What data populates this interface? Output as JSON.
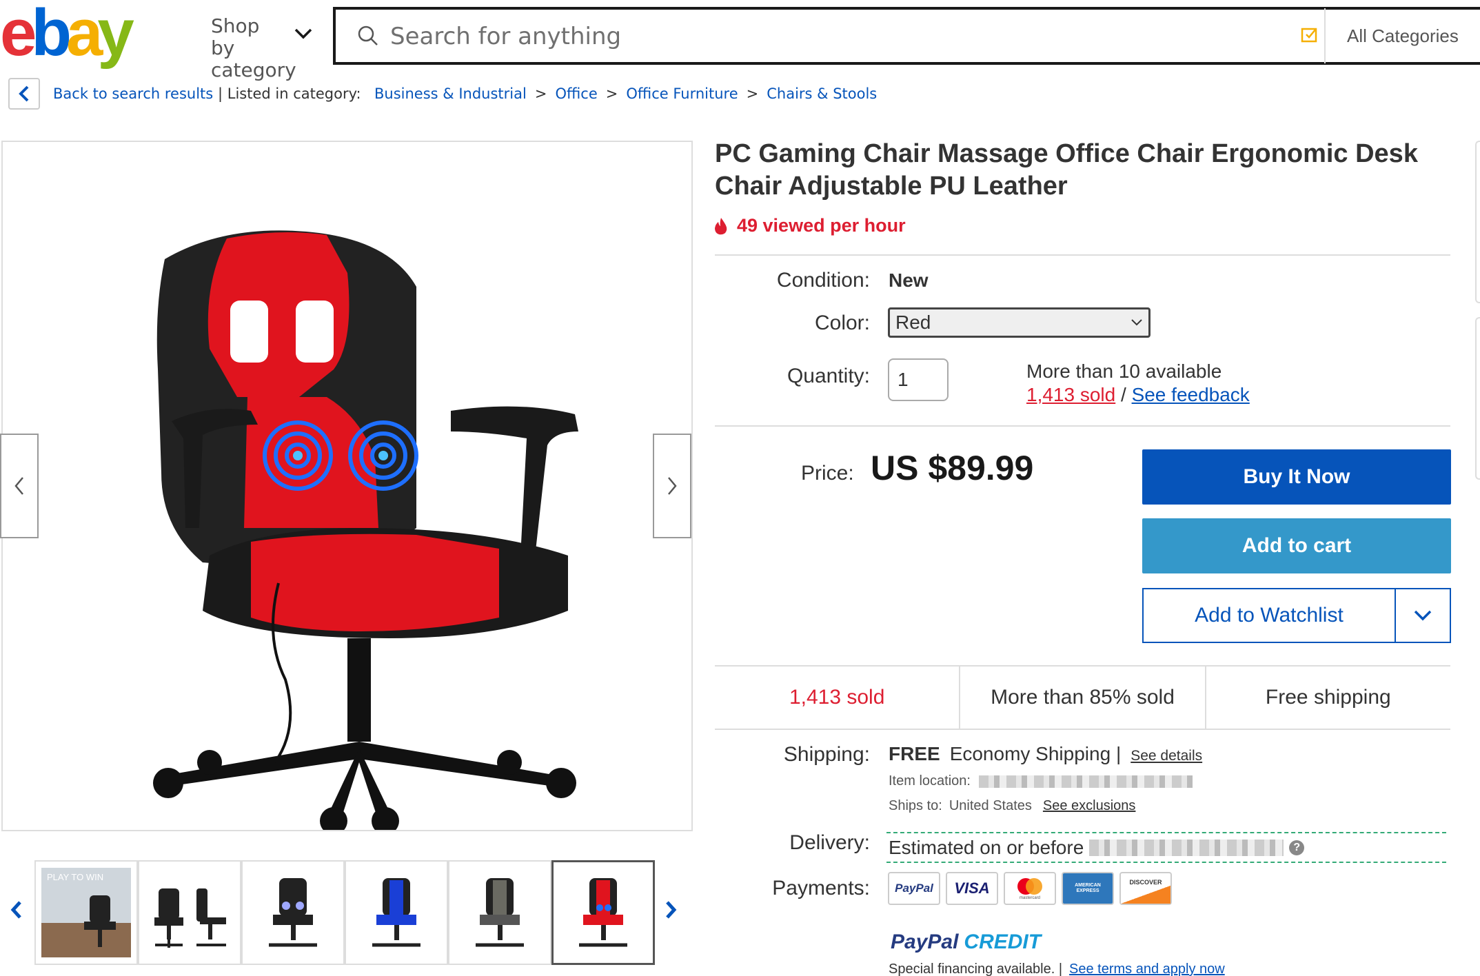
{
  "header": {
    "logo_text": "ebay",
    "shop_by_label": "Shop by category",
    "search_placeholder": "Search for anything",
    "all_categories": "All Categories"
  },
  "breadcrumb": {
    "back_label": "Back to search results",
    "listed_label": "| Listed in category:",
    "crumbs": [
      "Business & Industrial",
      "Office",
      "Office Furniture",
      "Chairs & Stools"
    ],
    "separator": ">"
  },
  "gallery": {
    "main_image": "red-gaming-chair-photo",
    "selected_thumb_index": 5,
    "thumbs": [
      "chair-in-office-scene",
      "chair-dimensions",
      "black-chair",
      "blue-chair",
      "camo-chair",
      "red-chair"
    ],
    "thumb_overlay_text": "PLAY TO WIN"
  },
  "product": {
    "title": "PC Gaming Chair Massage Office Chair Ergonomic Desk Chair Adjustable PU Leather",
    "views": "49 viewed per hour",
    "condition_label": "Condition:",
    "condition_value": "New",
    "color_label": "Color:",
    "color_value": "Red",
    "quantity_label": "Quantity:",
    "quantity_value": "1",
    "availability": "More than 10 available",
    "sold_count": "1,413 sold",
    "sold_sep": "/",
    "feedback_link": "See feedback",
    "price_label": "Price:",
    "price_value": "US $89.99"
  },
  "actions": {
    "buy_now": "Buy It Now",
    "add_to_cart": "Add to cart",
    "add_to_watchlist": "Add to Watchlist"
  },
  "stats": [
    "1,413 sold",
    "More than 85% sold",
    "Free shipping"
  ],
  "shipping": {
    "label": "Shipping:",
    "free": "FREE",
    "method": "Economy Shipping |",
    "details_link": "See details",
    "item_location_label": "Item location:",
    "ships_to_label": "Ships to:",
    "ships_to_value": "United States",
    "exclusions_link": "See exclusions"
  },
  "delivery": {
    "label": "Delivery:",
    "text": "Estimated on or before",
    "help": "?"
  },
  "payments": {
    "label": "Payments:",
    "cards": [
      "PayPal",
      "VISA",
      "mastercard",
      "AMERICAN EXPRESS",
      "DISCOVER"
    ],
    "paypal_credit_1": "PayPal",
    "paypal_credit_2": "CREDIT",
    "financing": "Special financing available. |",
    "financing_link": "See terms and apply now"
  },
  "colors": {
    "ebay_red": "#e53238",
    "ebay_blue": "#0064d2",
    "ebay_yellow": "#f5af02",
    "ebay_green": "#86b817",
    "link_blue": "#0654ba",
    "sold_red": "#dd1e31",
    "buy_blue": "#0654ba",
    "cart_blue": "#3498ca"
  }
}
